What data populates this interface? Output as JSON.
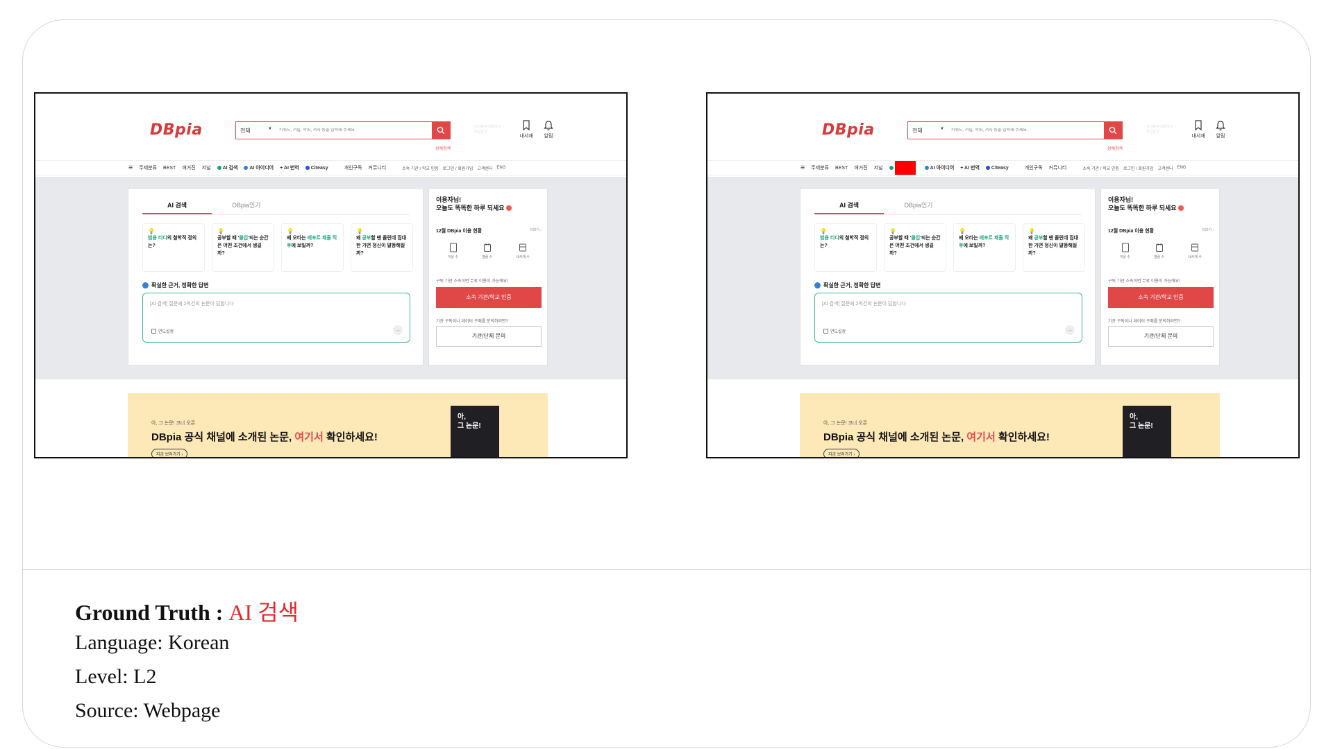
{
  "app": {
    "logo": "DBpia",
    "search_category": "전체",
    "search_placeholder": "키워드, 저널, 학회, 저자 등을 입력해 주세요.",
    "detail_search": "상세검색",
    "header_hint": "관심분야 설정하고 추천받기",
    "library_label": "내서재",
    "alarm_label": "알림",
    "nav": {
      "subject": "주제분류",
      "best": "BEST",
      "magazine": "매거진",
      "journal": "저널",
      "ai_search": "AI 검색",
      "ai_idea": "AI 아이디어",
      "ai_translate": "+ AI 번역",
      "citeasy": "Citeasy",
      "personal": "개인구독",
      "community": "커뮤니티",
      "institution": "소속 기관 / 학교 인증",
      "login": "로그인 / 회원가입",
      "support": "고객센터",
      "eng": "ENG"
    },
    "tabs": [
      "AI 검색",
      "DBpia인기"
    ],
    "questions": [
      {
        "pre": "",
        "hl": "범용 티디",
        "post": "의 철학적 정의는?"
      },
      {
        "pre": "공부할 때 '",
        "hl": "몰입",
        "post": "'되는 순간은 어떤 조건에서 생길까?"
      },
      {
        "pre": "왜 오타는 ",
        "hl": "레포트 제출 직후",
        "post": "에 보일까?"
      },
      {
        "pre": "왜 ",
        "hl": "공부",
        "post": "할 땐 졸린데 집대한 가면 정신이 말똥해질까?"
      }
    ],
    "subheading": "확실한 근거, 정확한 답변",
    "textarea_placeholder": "[AI 검색] 질문에 2억건의 논문이 답합니다",
    "textarea_option": "연도설정",
    "greeting_line1": "이용자님!",
    "greeting_line2": "오늘도 똑똑한 하루 되세요",
    "usage_title": "12월 DBpia 이용 현황",
    "usage_more": "더보기 ›",
    "stats": [
      "이용 수",
      "열람 수",
      "내서재 수"
    ],
    "info1": "구독 기관 소속이면 무료 이용이 가능해요!",
    "btn_institution": "소속 기관/학교 인증",
    "info2": "기관 구독이나 데이터 구매를 문의하려면?",
    "btn_inquiry": "기관/단체 문의",
    "banner_small": "아, 그 논문! 코너 오픈",
    "banner_pre": "DBpia 공식 채널에 소개된 논문, ",
    "banner_hl": "여기서",
    "banner_post": " 확인하세요!",
    "banner_btn": "지금 보러가기 ›",
    "book_text": "아,\n그 논문!"
  },
  "meta": {
    "gt_label": "Ground Truth : ",
    "gt_value": "AI 검색",
    "language": "Language: Korean",
    "level": "Level: L2",
    "source": "Source: Webpage"
  },
  "colors": {
    "accent": "#e04848",
    "green": "#19a37a",
    "mask": "#ff0000"
  }
}
